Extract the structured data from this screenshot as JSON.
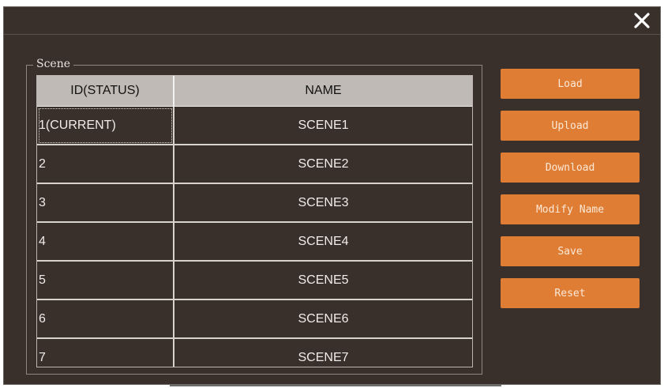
{
  "dialog": {
    "close_icon": "close-icon",
    "close_glyph": "✕"
  },
  "scene_group": {
    "legend": "Scene"
  },
  "table": {
    "columns": [
      "ID(STATUS)",
      "NAME"
    ],
    "rows": [
      {
        "id": "1(CURRENT)",
        "name": "SCENE1"
      },
      {
        "id": "2",
        "name": "SCENE2"
      },
      {
        "id": "3",
        "name": "SCENE3"
      },
      {
        "id": "4",
        "name": "SCENE4"
      },
      {
        "id": "5",
        "name": "SCENE5"
      },
      {
        "id": "6",
        "name": "SCENE6"
      },
      {
        "id": "7",
        "name": "SCENE7"
      }
    ],
    "selected_row": 0
  },
  "buttons": {
    "load": "Load",
    "upload": "Upload",
    "download": "Download",
    "modify_name": "Modify Name",
    "save": "Save",
    "reset": "Reset"
  },
  "colors": {
    "background": "#3a302b",
    "button": "#e07d34",
    "header": "#bfbab6"
  }
}
